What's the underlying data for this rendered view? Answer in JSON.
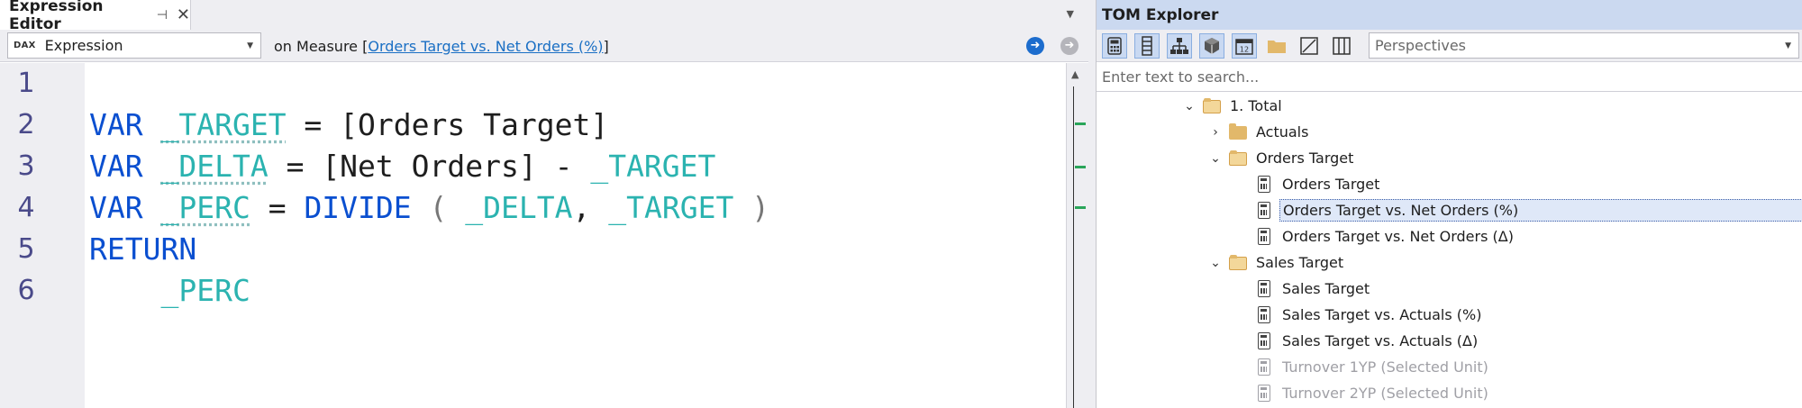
{
  "editor": {
    "tab_title": "Expression Editor",
    "mode_badge": "DAX",
    "mode_value": "Expression",
    "context_prefix": "on Measure [",
    "context_link": "Orders Target vs. Net Orders (%)",
    "context_suffix": "]",
    "line_numbers": [
      "1",
      "2",
      "3",
      "4",
      "5",
      "6"
    ],
    "code": {
      "l2": {
        "kw": "VAR",
        "v": "_TARGET",
        "eq": " = ",
        "rest": "[Orders Target]"
      },
      "l3": {
        "kw": "VAR",
        "v": "_DELTA",
        "eq": " = ",
        "rest": "[Net Orders] - ",
        "v2": "_TARGET"
      },
      "l4": {
        "kw": "VAR",
        "v": "_PERC",
        "eq": " = ",
        "fn": "DIVIDE",
        "p1": " ( ",
        "a1": "_DELTA",
        "c": ", ",
        "a2": "_TARGET",
        "p2": " )"
      },
      "l5": {
        "kw": "RETURN"
      },
      "l6": {
        "v": "_PERC"
      }
    }
  },
  "tom": {
    "title": "TOM Explorer",
    "perspectives_value": "Perspectives",
    "search_placeholder": "Enter text to search...",
    "toolbar_icons": [
      "calculator-icon",
      "column-icon",
      "hierarchy-icon",
      "cube-icon",
      "calendar-icon",
      "folder-icon",
      "kpi-icon",
      "columns-view-icon"
    ],
    "tree": [
      {
        "label": "1. Total",
        "type": "folder-open",
        "expanded": true
      },
      {
        "label": "Actuals",
        "type": "folder",
        "expanded": false
      },
      {
        "label": "Orders Target",
        "type": "folder-open",
        "expanded": true
      },
      {
        "label": "Orders Target",
        "type": "measure"
      },
      {
        "label": "Orders Target vs. Net Orders (%)",
        "type": "measure",
        "selected": true
      },
      {
        "label": "Orders Target vs. Net Orders (Δ)",
        "type": "measure"
      },
      {
        "label": "Sales Target",
        "type": "folder-open",
        "expanded": true
      },
      {
        "label": "Sales Target",
        "type": "measure"
      },
      {
        "label": "Sales Target vs. Actuals (%)",
        "type": "measure"
      },
      {
        "label": "Sales Target vs. Actuals (Δ)",
        "type": "measure"
      },
      {
        "label": "Turnover 1YP (Selected Unit)",
        "type": "measure",
        "hidden": true
      },
      {
        "label": "Turnover 2YP (Selected Unit)",
        "type": "measure",
        "hidden": true
      }
    ]
  }
}
